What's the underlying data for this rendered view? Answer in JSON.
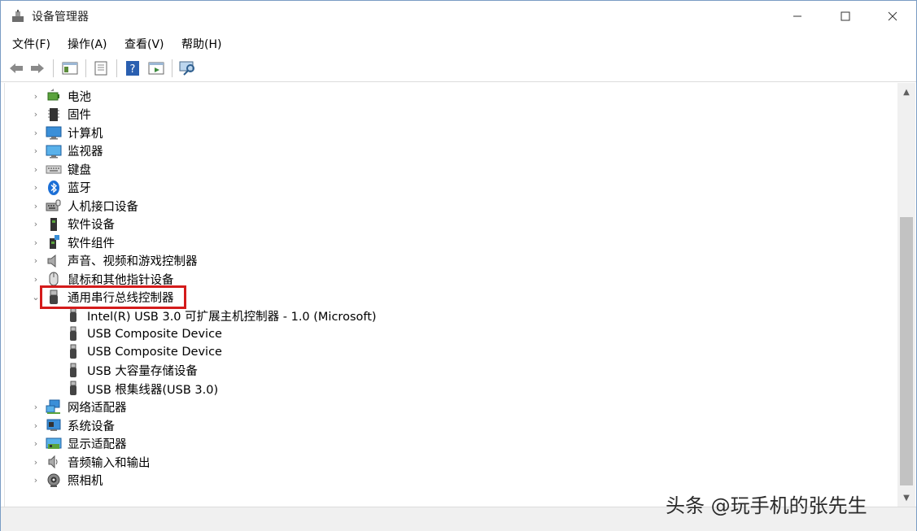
{
  "window": {
    "title": "设备管理器",
    "controls": {
      "minimize": "─",
      "maximize": "☐",
      "close": "✕"
    }
  },
  "menu": [
    "文件(F)",
    "操作(A)",
    "查看(V)",
    "帮助(H)"
  ],
  "toolbar": {
    "icons": [
      "back-arrow-icon",
      "forward-arrow-icon",
      "show-hide-console-tree-icon",
      "properties-icon",
      "help-icon",
      "action-pane-icon",
      "scan-hardware-icon"
    ]
  },
  "tree": {
    "expander_collapsed": "›",
    "expander_expanded": "⌄",
    "categories_before": [
      {
        "label": "电池",
        "icon": "battery-icon"
      },
      {
        "label": "固件",
        "icon": "firmware-chip-icon"
      },
      {
        "label": "计算机",
        "icon": "computer-icon"
      },
      {
        "label": "监视器",
        "icon": "monitor-icon"
      },
      {
        "label": "键盘",
        "icon": "keyboard-icon"
      },
      {
        "label": "蓝牙",
        "icon": "bluetooth-icon"
      },
      {
        "label": "人机接口设备",
        "icon": "hid-icon"
      },
      {
        "label": "软件设备",
        "icon": "software-device-icon"
      },
      {
        "label": "软件组件",
        "icon": "software-component-icon"
      },
      {
        "label": "声音、视频和游戏控制器",
        "icon": "speaker-icon"
      },
      {
        "label": "鼠标和其他指针设备",
        "icon": "mouse-icon"
      }
    ],
    "expanded_category": {
      "label": "通用串行总线控制器",
      "icon": "usb-icon"
    },
    "usb_children": [
      "Intel(R) USB 3.0 可扩展主机控制器 - 1.0 (Microsoft)",
      "USB Composite Device",
      "USB Composite Device",
      "USB 大容量存储设备",
      "USB 根集线器(USB 3.0)"
    ],
    "categories_after": [
      {
        "label": "网络适配器",
        "icon": "network-adapter-icon"
      },
      {
        "label": "系统设备",
        "icon": "system-device-icon"
      },
      {
        "label": "显示适配器",
        "icon": "display-adapter-icon"
      },
      {
        "label": "音频输入和输出",
        "icon": "audio-io-icon"
      },
      {
        "label": "照相机",
        "icon": "camera-icon"
      }
    ]
  },
  "scrollbar": {
    "up": "▲",
    "down": "▼"
  },
  "watermark": "头条 @玩手机的张先生",
  "colors": {
    "highlight_border": "#d41b1b",
    "window_border": "#7a9cc4"
  }
}
